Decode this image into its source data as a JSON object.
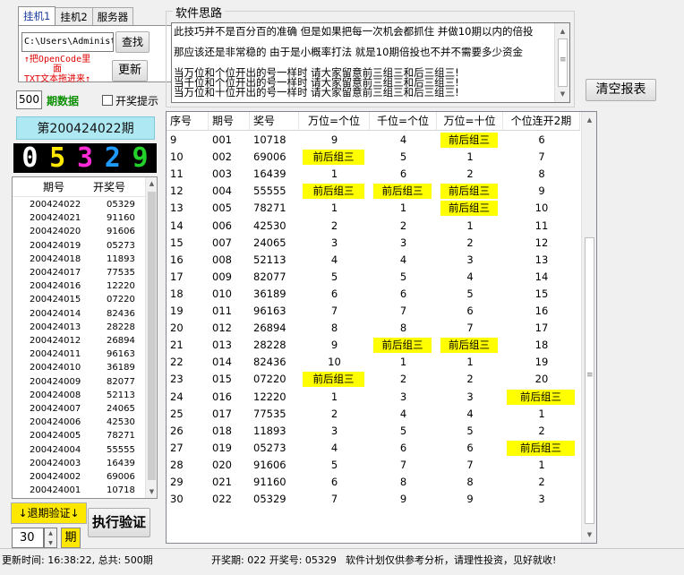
{
  "tabs": [
    {
      "label": "挂机1",
      "active": true
    },
    {
      "label": "挂机2",
      "active": false
    },
    {
      "label": "服务器",
      "active": false
    }
  ],
  "file": {
    "path": "C:\\Users\\Administ",
    "find_label": "查找",
    "drag_tip_1": "↑把OpenCode里面",
    "drag_tip_2": "TXT文本拖进来↑",
    "update_label": "更新"
  },
  "data_count": {
    "value": "500",
    "label": "期数据",
    "checkbox_label": "开奖提示"
  },
  "current_period": "第200424022期",
  "current_digits": [
    {
      "digit": "0",
      "color": "#ffffff"
    },
    {
      "digit": "5",
      "color": "#ffe800"
    },
    {
      "digit": "3",
      "color": "#ff2bd6"
    },
    {
      "digit": "2",
      "color": "#1f9bff"
    },
    {
      "digit": "9",
      "color": "#22d12a"
    }
  ],
  "history": {
    "headers": [
      "期号",
      "开奖号"
    ],
    "rows": [
      [
        "200424022",
        "05329"
      ],
      [
        "200424021",
        "91160"
      ],
      [
        "200424020",
        "91606"
      ],
      [
        "200424019",
        "05273"
      ],
      [
        "200424018",
        "11893"
      ],
      [
        "200424017",
        "77535"
      ],
      [
        "200424016",
        "12220"
      ],
      [
        "200424015",
        "07220"
      ],
      [
        "200424014",
        "82436"
      ],
      [
        "200424013",
        "28228"
      ],
      [
        "200424012",
        "26894"
      ],
      [
        "200424011",
        "96163"
      ],
      [
        "200424010",
        "36189"
      ],
      [
        "200424009",
        "82077"
      ],
      [
        "200424008",
        "52113"
      ],
      [
        "200424007",
        "24065"
      ],
      [
        "200424006",
        "42530"
      ],
      [
        "200424005",
        "78271"
      ],
      [
        "200424004",
        "55555"
      ],
      [
        "200424003",
        "16439"
      ],
      [
        "200424002",
        "69006"
      ],
      [
        "200424001",
        "10718"
      ]
    ]
  },
  "controls": {
    "back_label": "↓退期验证↓",
    "exec_label": "执行验证",
    "spin_value": "30",
    "qi_label": "期",
    "clear_label": "清空报表"
  },
  "notes": {
    "title": "软件思路",
    "lines": [
      "此技巧并不是百分百的准确 但是如果把每一次机会都抓住 并做10期以内的倍投",
      "那应该还是非常稳的  由于是小概率打法  就是10期倍投也不并不需要多少资金",
      "当万位和个位开出的号一样时 请大家留意前三组三和后三组三!",
      "当千位和个位开出的号一样时 请大家留意前三组三和后三组三!",
      "当万位和十位开出的号一样时 请大家留意前三组三和后三组三!"
    ]
  },
  "grid": {
    "headers": [
      "序号",
      "期号",
      "奖号",
      "万位=个位",
      "千位=个位",
      "万位=十位",
      "个位连开2期"
    ],
    "rows": [
      [
        "9",
        "001",
        "10718",
        "9",
        "4",
        "前后组三",
        "6"
      ],
      [
        "10",
        "002",
        "69006",
        "前后组三",
        "5",
        "1",
        "7"
      ],
      [
        "11",
        "003",
        "16439",
        "1",
        "6",
        "2",
        "8"
      ],
      [
        "12",
        "004",
        "55555",
        "前后组三",
        "前后组三",
        "前后组三",
        "9"
      ],
      [
        "13",
        "005",
        "78271",
        "1",
        "1",
        "前后组三",
        "10"
      ],
      [
        "14",
        "006",
        "42530",
        "2",
        "2",
        "1",
        "11"
      ],
      [
        "15",
        "007",
        "24065",
        "3",
        "3",
        "2",
        "12"
      ],
      [
        "16",
        "008",
        "52113",
        "4",
        "4",
        "3",
        "13"
      ],
      [
        "17",
        "009",
        "82077",
        "5",
        "5",
        "4",
        "14"
      ],
      [
        "18",
        "010",
        "36189",
        "6",
        "6",
        "5",
        "15"
      ],
      [
        "19",
        "011",
        "96163",
        "7",
        "7",
        "6",
        "16"
      ],
      [
        "20",
        "012",
        "26894",
        "8",
        "8",
        "7",
        "17"
      ],
      [
        "21",
        "013",
        "28228",
        "9",
        "前后组三",
        "前后组三",
        "18"
      ],
      [
        "22",
        "014",
        "82436",
        "10",
        "1",
        "1",
        "19"
      ],
      [
        "23",
        "015",
        "07220",
        "前后组三",
        "2",
        "2",
        "20"
      ],
      [
        "24",
        "016",
        "12220",
        "1",
        "3",
        "3",
        "前后组三"
      ],
      [
        "25",
        "017",
        "77535",
        "2",
        "4",
        "4",
        "1"
      ],
      [
        "26",
        "018",
        "11893",
        "3",
        "5",
        "5",
        "2"
      ],
      [
        "27",
        "019",
        "05273",
        "4",
        "6",
        "6",
        "前后组三"
      ],
      [
        "28",
        "020",
        "91606",
        "5",
        "7",
        "7",
        "1"
      ],
      [
        "29",
        "021",
        "91160",
        "6",
        "8",
        "8",
        "2"
      ],
      [
        "30",
        "022",
        "05329",
        "7",
        "9",
        "9",
        "3"
      ]
    ]
  },
  "status": {
    "update_time": "更新时间: 16:38:22, 总共: 500期",
    "draw_info": "开奖期: 022 开奖号: 05329",
    "disclaimer": "软件计划仅供参考分析，请理性投资，见好就收!"
  },
  "colors": {
    "highlight": "#ffff00",
    "period_bg": "#aee8f3",
    "accent_button": "#ffe800"
  }
}
